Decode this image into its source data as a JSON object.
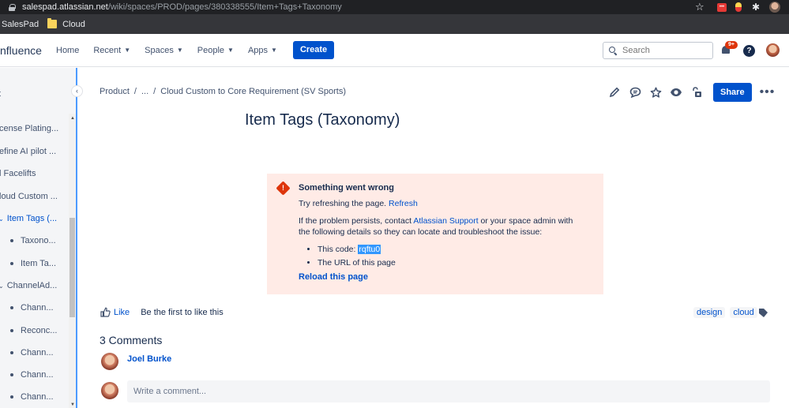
{
  "browser": {
    "url_host": "salespad.atlassian.net",
    "url_path": "/wiki/spaces/PROD/pages/380338555/Item+Tags+Taxonomy",
    "bookmarks": [
      "SalesPad",
      "Cloud"
    ]
  },
  "topnav": {
    "logo": "nfluence",
    "items": [
      "Home",
      "Recent",
      "Spaces",
      "People",
      "Apps"
    ],
    "create": "Create",
    "search_placeholder": "Search",
    "notifications_badge": "9+",
    "help": "?"
  },
  "sidebar": {
    "items": [
      {
        "label": "t"
      },
      {
        "label": "cense Plating..."
      },
      {
        "label": "efine AI pilot ..."
      },
      {
        "label": "l Facelifts"
      },
      {
        "label": "loud Custom ..."
      },
      {
        "label": "Item Tags (..."
      },
      {
        "label": "Taxono..."
      },
      {
        "label": "Item Ta..."
      },
      {
        "label": "ChannelAd..."
      },
      {
        "label": "Chann..."
      },
      {
        "label": "Reconc..."
      },
      {
        "label": "Chann..."
      },
      {
        "label": "Chann..."
      },
      {
        "label": "Chann..."
      }
    ]
  },
  "breadcrumb": {
    "items": [
      "Product",
      "/",
      "...",
      "/",
      "Cloud Custom to Core Requirement (SV Sports)"
    ]
  },
  "page_actions": {
    "share": "Share",
    "icons": [
      "edit-icon",
      "comment-icon",
      "star-icon",
      "watch-icon",
      "restrictions-icon"
    ]
  },
  "page": {
    "title": "Item Tags (Taxonomy)"
  },
  "error": {
    "title": "Something went wrong",
    "try_text": "Try refreshing the page. ",
    "refresh_link": "Refresh",
    "persist_before": "If the problem persists, contact ",
    "support_link": "Atlassian Support",
    "persist_after": " or your space admin with the following details so they can locate and troubleshoot the issue:",
    "code_label": "This code: ",
    "code": "rqftu0",
    "url_item": "The URL of this page",
    "reload": "Reload this page"
  },
  "likes": {
    "like": "Like",
    "text": "Be the first to like this"
  },
  "labels": [
    "design",
    "cloud"
  ],
  "comments": {
    "heading": "3 Comments",
    "first_author": "Joel Burke",
    "placeholder": "Write a comment..."
  }
}
